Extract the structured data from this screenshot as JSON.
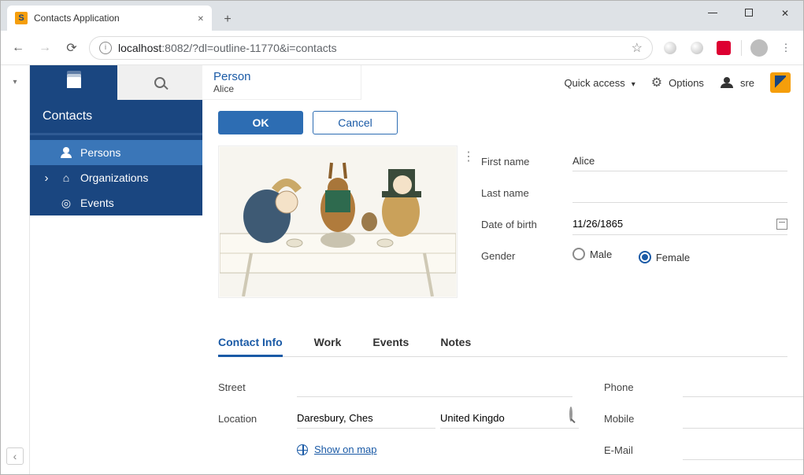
{
  "browser": {
    "tab_title": "Contacts Application",
    "url_display": "localhost:8082/?dl=outline-11770&i=contacts",
    "url_host": "localhost",
    "url_rest": ":8082/?dl=outline-11770&i=contacts"
  },
  "toolbar": {
    "quick_access": "Quick access",
    "options": "Options",
    "user": "sre"
  },
  "sidebar": {
    "title": "Contacts",
    "items": [
      {
        "label": "Persons",
        "icon": "person-icon",
        "selected": true,
        "expandable": false
      },
      {
        "label": "Organizations",
        "icon": "home-icon",
        "selected": false,
        "expandable": true
      },
      {
        "label": "Events",
        "icon": "target-icon",
        "selected": false,
        "expandable": false
      }
    ]
  },
  "header": {
    "entity_type": "Person",
    "entity_name": "Alice"
  },
  "buttons": {
    "ok": "OK",
    "cancel": "Cancel"
  },
  "form": {
    "first_name_label": "First name",
    "first_name": "Alice",
    "last_name_label": "Last name",
    "last_name": "",
    "dob_label": "Date of birth",
    "dob": "11/26/1865",
    "gender_label": "Gender",
    "gender_options": {
      "male": "Male",
      "female": "Female"
    },
    "gender_selected": "female"
  },
  "tabs": [
    {
      "key": "contact",
      "label": "Contact Info",
      "active": true
    },
    {
      "key": "work",
      "label": "Work",
      "active": false
    },
    {
      "key": "events",
      "label": "Events",
      "active": false
    },
    {
      "key": "notes",
      "label": "Notes",
      "active": false
    }
  ],
  "contact_info": {
    "street_label": "Street",
    "street": "",
    "location_label": "Location",
    "location_city": "Daresbury, Ches",
    "location_country": "United Kingdo",
    "map_link": "Show on map",
    "phone_label": "Phone",
    "phone": "",
    "mobile_label": "Mobile",
    "mobile": "",
    "email_label": "E-Mail",
    "email": ""
  }
}
